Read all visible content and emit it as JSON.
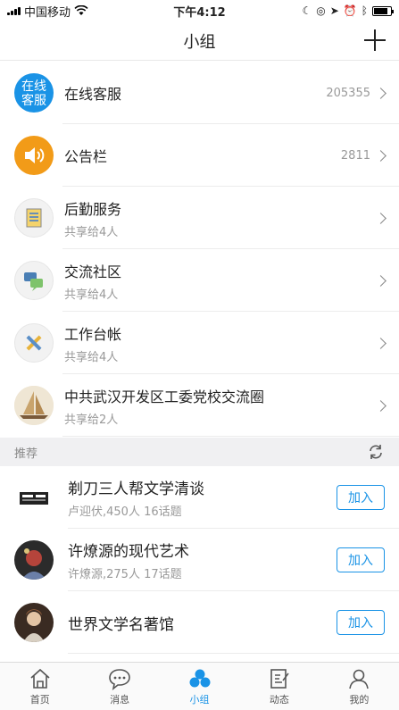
{
  "status_bar": {
    "carrier": "中国移动",
    "time": "下午4:12"
  },
  "nav": {
    "title": "小组"
  },
  "groups": [
    {
      "icon": "service-icon",
      "icon_text": "在线\n客服",
      "title": "在线客服",
      "subtitle": "",
      "count": "205355"
    },
    {
      "icon": "speaker-icon",
      "title": "公告栏",
      "subtitle": "",
      "count": "2811"
    },
    {
      "icon": "document-icon",
      "title": "后勤服务",
      "subtitle": "共享给4人",
      "count": ""
    },
    {
      "icon": "chat-bubbles-icon",
      "title": "交流社区",
      "subtitle": "共享给4人",
      "count": ""
    },
    {
      "icon": "tools-icon",
      "title": "工作台帐",
      "subtitle": "共享给4人",
      "count": ""
    },
    {
      "icon": "sailboat-icon",
      "title": "中共武汉开发区工委党校交流圈",
      "subtitle": "共享给2人",
      "count": ""
    }
  ],
  "recommend": {
    "label": "推荐",
    "join_label": "加入",
    "items": [
      {
        "icon": "group-avatar-1",
        "title": "剃刀三人帮文学清谈",
        "subtitle": "卢迎伏,450人 16话题"
      },
      {
        "icon": "group-avatar-2",
        "title": "许燎源的现代艺术",
        "subtitle": "许燎源,275人 17话题"
      },
      {
        "icon": "group-avatar-3",
        "title": "世界文学名著馆",
        "subtitle": ""
      }
    ]
  },
  "tabs": [
    {
      "label": "首页",
      "icon": "home-icon",
      "active": false
    },
    {
      "label": "消息",
      "icon": "message-icon",
      "active": false
    },
    {
      "label": "小组",
      "icon": "group-icon",
      "active": true
    },
    {
      "label": "动态",
      "icon": "feed-icon",
      "active": false
    },
    {
      "label": "我的",
      "icon": "profile-icon",
      "active": false
    }
  ],
  "colors": {
    "accent": "#1a93e6",
    "notice": "#f29b18"
  }
}
